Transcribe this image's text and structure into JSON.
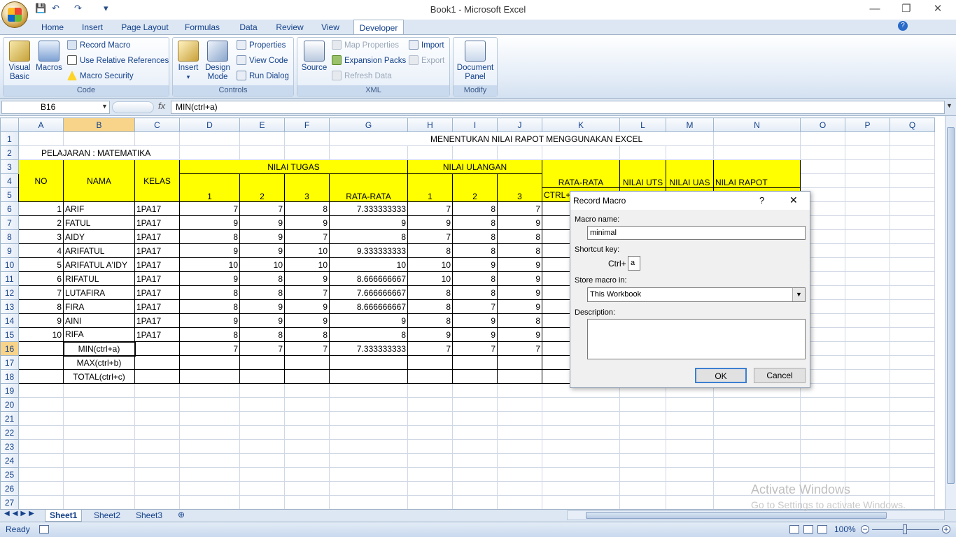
{
  "window": {
    "title": "Book1 - Microsoft Excel",
    "minimize": "—",
    "restore": "❐",
    "close": "✕"
  },
  "qat": {
    "save": "💾",
    "undo": "↶",
    "redo": "↷",
    "more": "▾"
  },
  "ribbon_tabs": [
    "Home",
    "Insert",
    "Page Layout",
    "Formulas",
    "Data",
    "Review",
    "View",
    "Developer"
  ],
  "active_tab": "Developer",
  "ribbon": {
    "code": {
      "title": "Code",
      "visual_basic": "Visual Basic",
      "macros": "Macros",
      "record_macro": "Record Macro",
      "use_relative": "Use Relative References",
      "macro_security": "Macro Security"
    },
    "controls": {
      "title": "Controls",
      "insert": "Insert",
      "design_mode": "Design Mode",
      "properties": "Properties",
      "view_code": "View Code",
      "run_dialog": "Run Dialog"
    },
    "xml": {
      "title": "XML",
      "source": "Source",
      "map_properties": "Map Properties",
      "expansion_packs": "Expansion Packs",
      "refresh_data": "Refresh Data",
      "import": "Import",
      "export": "Export"
    },
    "modify": {
      "title": "Modify",
      "document_panel": "Document Panel"
    }
  },
  "formula_bar": {
    "name_box": "B16",
    "fx": "fx",
    "formula": "MIN(ctrl+a)"
  },
  "columns": [
    "A",
    "B",
    "C",
    "D",
    "E",
    "F",
    "G",
    "H",
    "I",
    "J",
    "K",
    "L",
    "M",
    "N",
    "O",
    "P",
    "Q"
  ],
  "sheet": {
    "title": "MENENTUKAN NILAI RAPOT MENGGUNAKAN EXCEL",
    "subject": "PELAJARAN : MATEMATIKA",
    "headers": {
      "no": "NO",
      "nama": "NAMA",
      "kelas": "KELAS",
      "nilai_tugas": "NILAI TUGAS",
      "nilai_ulangan": "NILAI ULANGAN",
      "rata_rata": "RATA-RATA",
      "nilai_uts": "NILAI UTS",
      "nilai_uas": "NILAI UAS",
      "nilai_rapot": "NILAI RAPOT",
      "ctrl": "CTRL+",
      "sub1": "1",
      "sub2": "2",
      "sub3": "3",
      "sub_rata": "RATA-RATA"
    },
    "rows": [
      [
        "1",
        "ARIF",
        "1PA17",
        "7",
        "7",
        "8",
        "7.333333333",
        "7",
        "8",
        "7",
        "7"
      ],
      [
        "2",
        "FATUL",
        "1PA17",
        "9",
        "9",
        "9",
        "9",
        "9",
        "8",
        "9",
        "8"
      ],
      [
        "3",
        "AIDY",
        "1PA17",
        "8",
        "9",
        "7",
        "8",
        "7",
        "8",
        "8",
        "7"
      ],
      [
        "4",
        "ARIFATUL",
        "1PA17",
        "9",
        "9",
        "10",
        "9.333333333",
        "8",
        "8",
        "8",
        ""
      ],
      [
        "5",
        "ARIFATUL A'IDY",
        "1PA17",
        "10",
        "10",
        "10",
        "10",
        "10",
        "9",
        "9",
        "9"
      ],
      [
        "6",
        "RIFATUL",
        "1PA17",
        "9",
        "8",
        "9",
        "8.666666667",
        "10",
        "8",
        "9",
        ""
      ],
      [
        "7",
        "LUTAFIRA",
        "1PA17",
        "8",
        "8",
        "7",
        "7.666666667",
        "8",
        "8",
        "9",
        "8"
      ],
      [
        "8",
        "FIRA",
        "1PA17",
        "8",
        "9",
        "9",
        "8.666666667",
        "8",
        "7",
        "9",
        ""
      ],
      [
        "9",
        "AINI",
        "1PA17",
        "9",
        "9",
        "9",
        "9",
        "8",
        "9",
        "8",
        "8"
      ],
      [
        "10",
        "RIFA",
        "1PA17",
        "8",
        "8",
        "8",
        "8",
        "9",
        "9",
        "9",
        ""
      ]
    ],
    "min_label": "MIN(ctrl+a)",
    "min_values": [
      "7",
      "7",
      "7",
      "7.333333333",
      "7",
      "7",
      "7",
      "7"
    ],
    "max_label": "MAX(ctrl+b)",
    "total_label": "TOTAL(ctrl+c)"
  },
  "sheet_tabs": [
    "Sheet1",
    "Sheet2",
    "Sheet3"
  ],
  "status": {
    "ready": "Ready",
    "zoom": "100%"
  },
  "watermark": {
    "line1": "Activate Windows",
    "line2": "Go to Settings to activate Windows."
  },
  "dialog": {
    "title": "Record Macro",
    "help": "?",
    "close": "✕",
    "macro_name_label": "Macro name:",
    "macro_name": "minimal",
    "shortcut_label": "Shortcut key:",
    "ctrl": "Ctrl+",
    "shortcut": "a",
    "store_label": "Store macro in:",
    "store_value": "This Workbook",
    "description_label": "Description:",
    "ok": "OK",
    "cancel": "Cancel"
  }
}
